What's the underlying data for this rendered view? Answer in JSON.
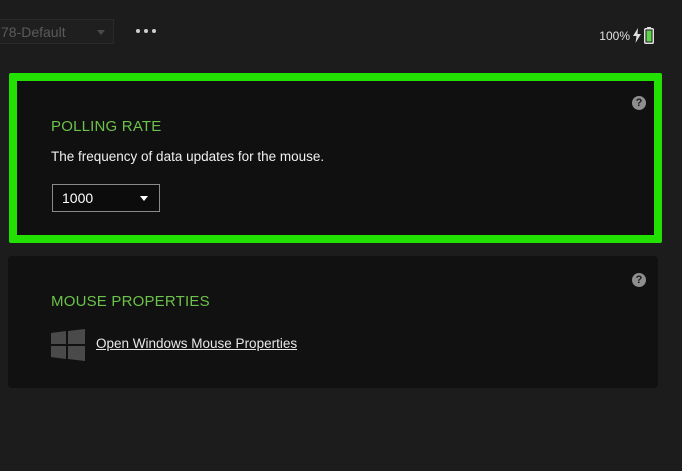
{
  "topbar": {
    "profile_value": "78-Default",
    "more_icon": "more-horizontal-icon",
    "battery_text": "100%",
    "battery_icon": "battery-charging-icon"
  },
  "polling": {
    "title": "POLLING RATE",
    "description": "The frequency of data updates for the mouse.",
    "rate_value": "1000",
    "help_label": "?",
    "highlight_color": "#22e000"
  },
  "mouse_properties": {
    "title": "MOUSE PROPERTIES",
    "link_label": "Open Windows Mouse Properties",
    "help_label": "?",
    "logo_icon": "windows-logo-icon"
  },
  "colors": {
    "accent_green": "#6cc24a",
    "background": "#1c1c1c",
    "panel": "#101010"
  }
}
